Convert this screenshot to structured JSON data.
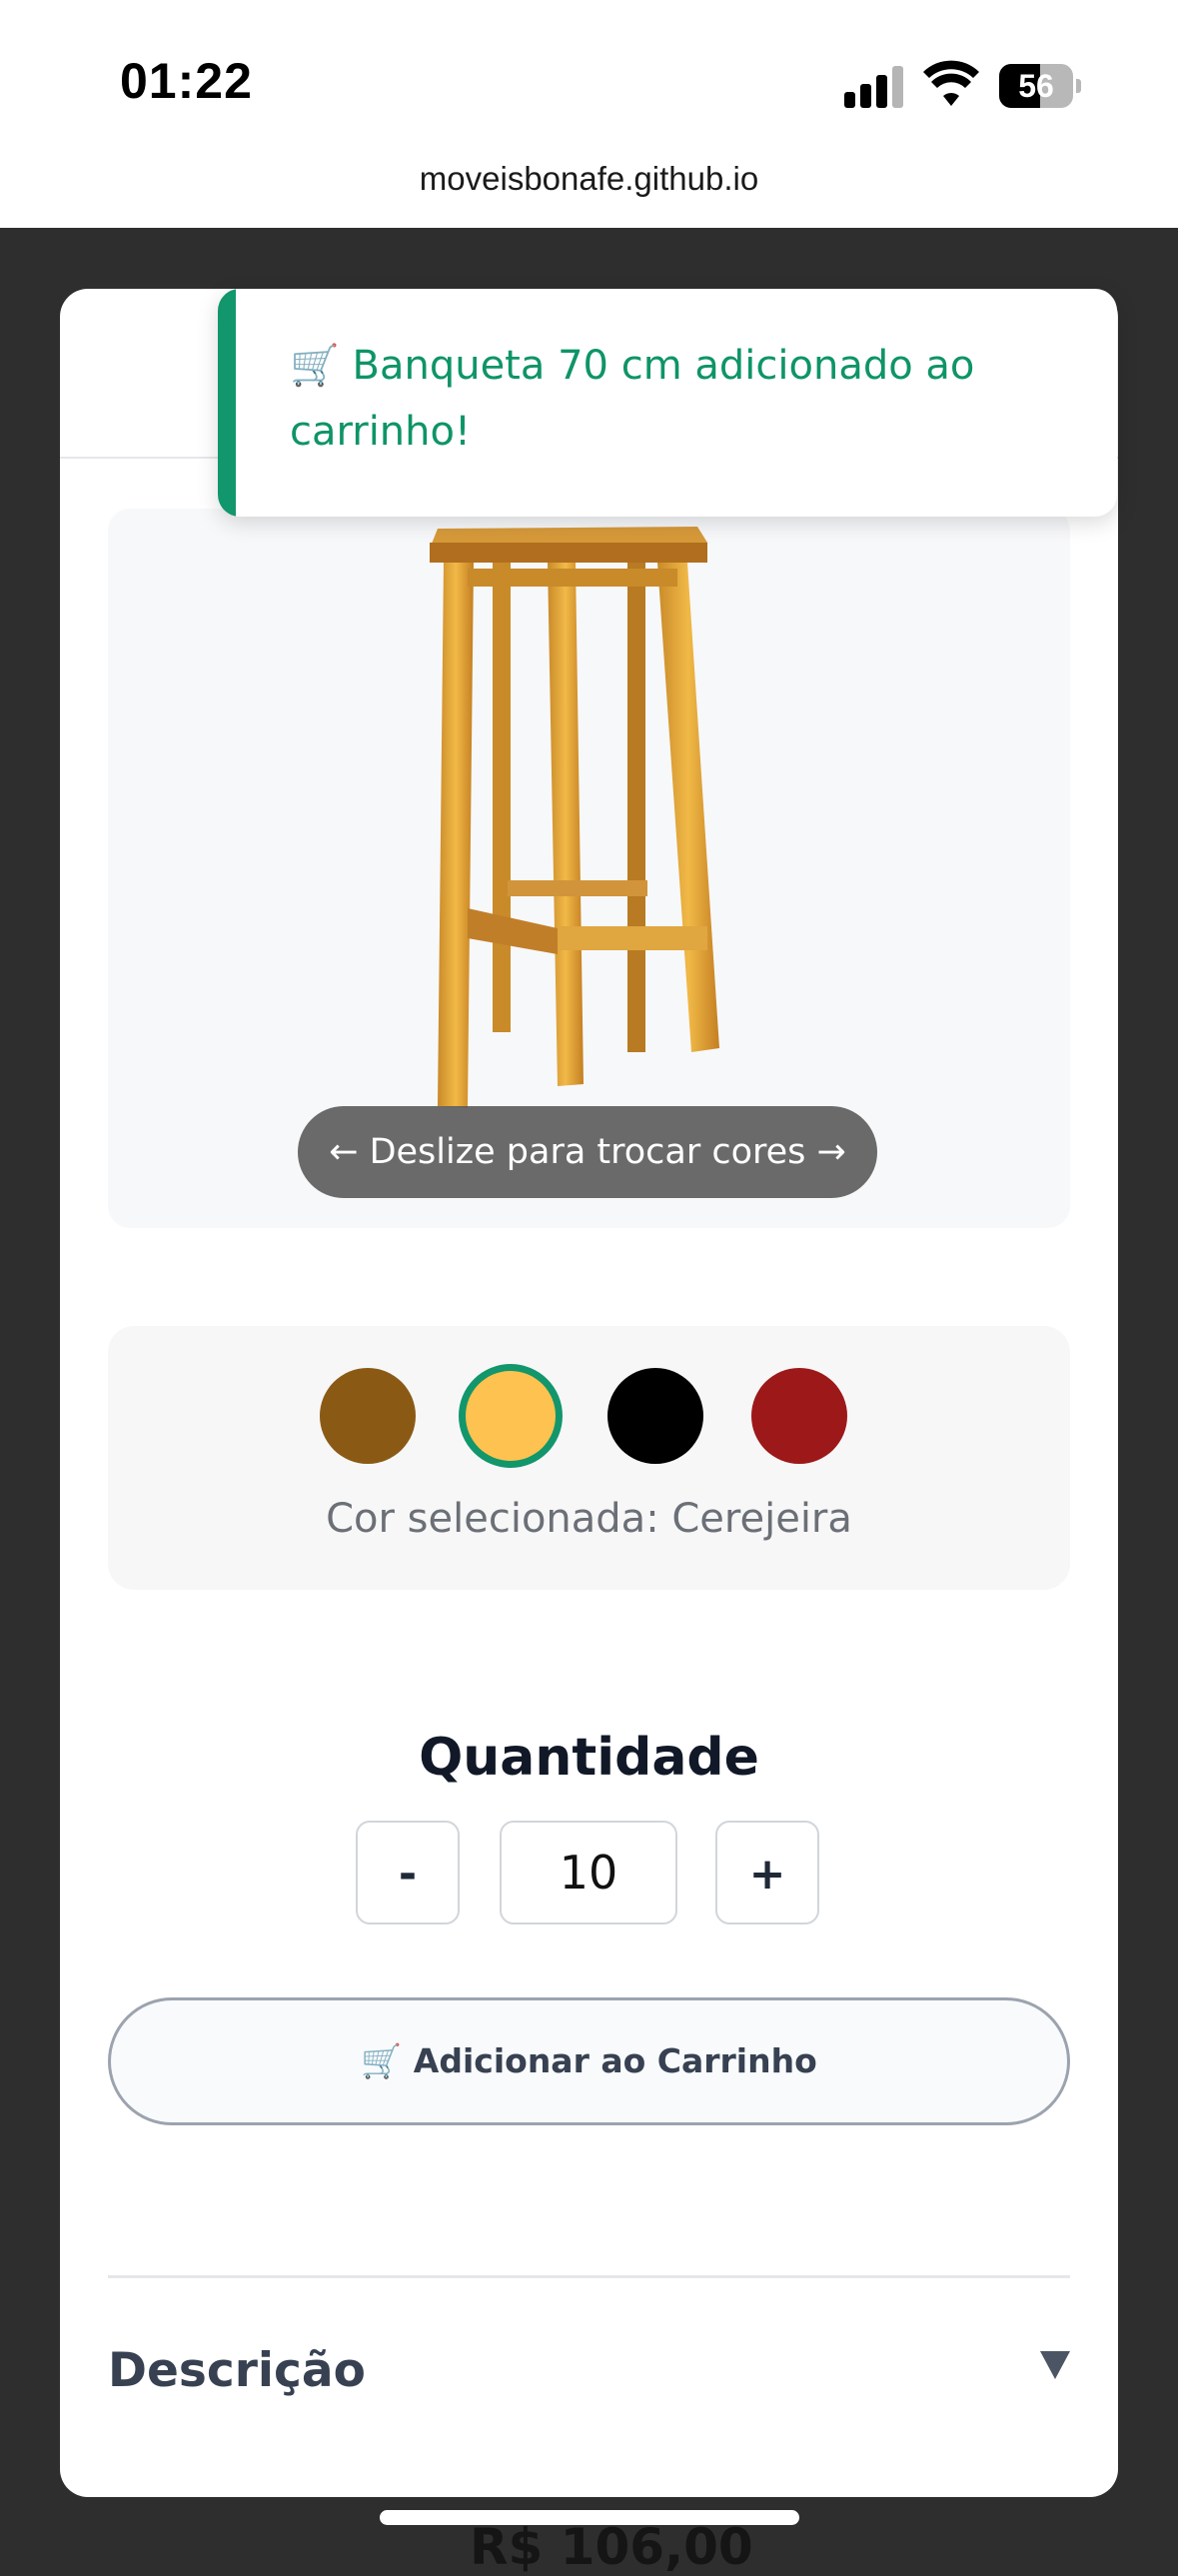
{
  "status_bar": {
    "time": "01:22",
    "battery": "56",
    "battery_level_percent": 56,
    "url": "moveisbonafe.github.io"
  },
  "toast": {
    "message": "🛒 Banqueta 70 cm adicionado ao carrinho!",
    "accent_color": "#12966b"
  },
  "product": {
    "swipe_hint": "← Deslize para trocar cores →",
    "colors": [
      {
        "name": "swatch-1",
        "hex": "#8a5a15",
        "selected": false
      },
      {
        "name": "swatch-cerejeira",
        "hex": "#fdc24f",
        "selected": true
      },
      {
        "name": "swatch-3",
        "hex": "#000000",
        "selected": false
      },
      {
        "name": "swatch-4",
        "hex": "#9d1818",
        "selected": false
      }
    ],
    "selected_color_text": "Cor selecionada: Cerejeira"
  },
  "quantity": {
    "title": "Quantidade",
    "minus": "-",
    "value": "10",
    "plus": "+"
  },
  "cart_button": {
    "label": "🛒 Adicionar ao Carrinho"
  },
  "description": {
    "title": "Descrição"
  },
  "background_peek": {
    "price": "R$ 106,00"
  }
}
